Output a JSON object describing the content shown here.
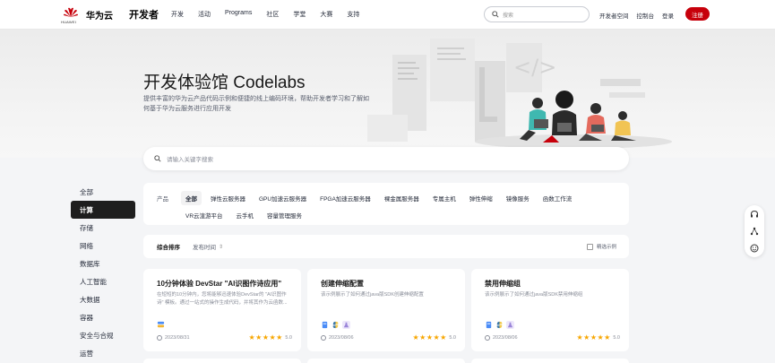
{
  "header": {
    "brand": "华为云",
    "logo_small": "HUAWEI",
    "developer": "开发者",
    "nav": [
      "开发",
      "活动",
      "Programs",
      "社区",
      "学堂",
      "大赛",
      "支持"
    ],
    "search_placeholder": "搜索",
    "right_links": [
      "开发者空间",
      "控制台",
      "登录"
    ],
    "register": "注册",
    "accent": "#c7000b"
  },
  "hero": {
    "title": "开发体验馆 Codelabs",
    "description": "提供丰富的华为云产品代码示例和便捷的线上编码环境，帮助开发者学习和了解如何基于华为云服务进行应用开发"
  },
  "search": {
    "placeholder": "请输入关键字搜索"
  },
  "sidebar": {
    "items": [
      {
        "label": "全部",
        "active": false
      },
      {
        "label": "计算",
        "active": true
      },
      {
        "label": "存储",
        "active": false
      },
      {
        "label": "网络",
        "active": false
      },
      {
        "label": "数据库",
        "active": false
      },
      {
        "label": "人工智能",
        "active": false
      },
      {
        "label": "大数据",
        "active": false
      },
      {
        "label": "容器",
        "active": false
      },
      {
        "label": "安全与合规",
        "active": false
      },
      {
        "label": "运营",
        "active": false
      }
    ]
  },
  "filter": {
    "label": "产品",
    "chips": [
      "全部",
      "弹性云服务器",
      "GPU加速云服务器",
      "FPGA加速云服务器",
      "裸金属服务器",
      "专属主机",
      "弹性伸缩",
      "镜像服务",
      "函数工作流",
      "VR云渲游平台",
      "云手机",
      "容量管理服务"
    ],
    "active_index": 0
  },
  "sort": {
    "primary": "综合排序",
    "secondary": "发布时间",
    "secondary_icon": "sort-icon",
    "checkbox_label": "精选示例"
  },
  "cards": [
    {
      "title": "10分钟体验 DevStar \"AI识图作诗应用\"",
      "desc": "在短短的10分钟内，您将能够迅速体验DevStar的 \"AI识图作诗\" 模板。通过一站式的操作生成代码，并将其作为云函数...",
      "date": "2023/08/31",
      "score": "5.0",
      "icons": [
        "#4a8cf7",
        "#f2b533"
      ]
    },
    {
      "title": "创建伸缩配置",
      "desc": "该示例展示了如何通过java版SDK创建伸缩配置",
      "date": "2023/08/06",
      "score": "5.0",
      "icons": [
        "#4a8cf7",
        "#f2b533",
        "#c8b8f0"
      ]
    },
    {
      "title": "禁用伸缩组",
      "desc": "该示例展示了如何通过java版SDK禁用伸缩组",
      "date": "2023/08/06",
      "score": "5.0",
      "icons": [
        "#4a8cf7",
        "#f2b533",
        "#c8b8f0"
      ]
    }
  ],
  "float_tools": [
    "headset-icon",
    "share-icon",
    "smile-icon"
  ]
}
